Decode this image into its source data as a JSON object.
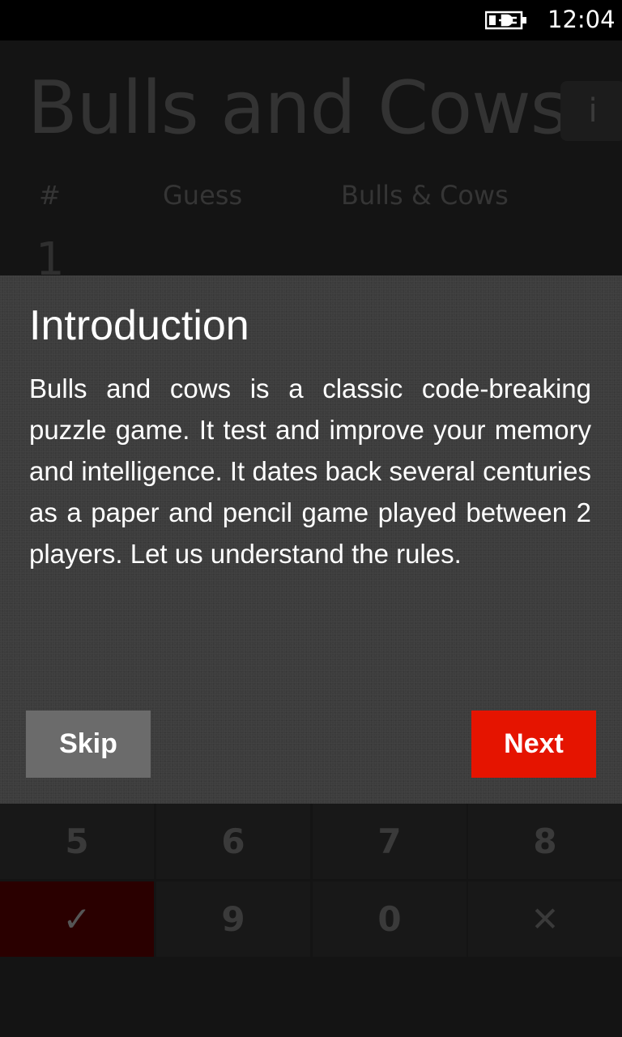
{
  "status_bar": {
    "time": "12:04",
    "battery_icon": "battery-charging-icon"
  },
  "game": {
    "title": "Bulls and Cows",
    "info_label": "i",
    "columns": [
      "#",
      "Guess",
      "Bulls & Cows"
    ],
    "row_number": "1"
  },
  "modal": {
    "title": "Introduction",
    "body": "Bulls and cows is a classic code-breaking puzzle game. It test and improve your memory and intelligence. It dates back several centuries as a paper and pencil game played between 2 players. Let us understand the rules.",
    "skip_label": "Skip",
    "next_label": "Next"
  },
  "keypad": {
    "row1": [
      "5",
      "6",
      "7",
      "8"
    ],
    "row2": [
      "✓",
      "9",
      "0",
      "✕"
    ]
  },
  "colors": {
    "accent": "#e51400",
    "skip": "#6b6b6b",
    "confirm": "#2a0000"
  }
}
